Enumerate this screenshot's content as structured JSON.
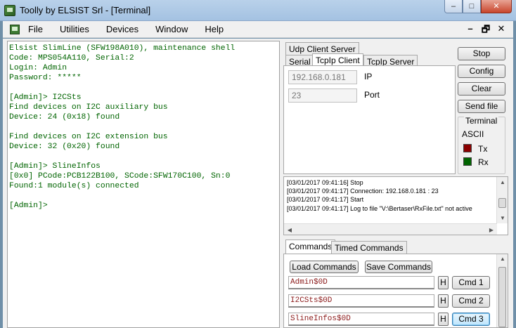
{
  "window": {
    "title": "Toolly by ELSIST Srl - [Terminal]",
    "min_glyph": "–",
    "max_glyph": "□",
    "close_glyph": "✕"
  },
  "menu": {
    "items": [
      "File",
      "Utilities",
      "Devices",
      "Window",
      "Help"
    ],
    "mdi_min": "–",
    "mdi_restore": "🗗",
    "mdi_close": "✕"
  },
  "terminal": {
    "lines": [
      "Elsist SlimLine (SFW198A010), maintenance shell",
      "Code: MPS054A110, Serial:2",
      "Login: Admin",
      "Password: *****",
      "",
      "[Admin]> I2CSts",
      "Find devices on I2C auxiliary bus",
      "Device: 24 (0x18) found",
      "",
      "Find devices on I2C extension bus",
      "Device: 32 (0x20) found",
      "",
      "[Admin]> SlineInfos",
      "[0x0] PCode:PCB122B100, SCode:SFW170C100, Sn:0",
      "Found:1 module(s) connected",
      "",
      "[Admin]>"
    ],
    "color": "#006400"
  },
  "connection": {
    "tabs_top": [
      "Udp Client Server"
    ],
    "tabs": [
      "Serial",
      "TcpIp Client",
      "TcpIp Server"
    ],
    "active_tab": "TcpIp Client",
    "ip_value": "192.168.0.181",
    "ip_label": "IP",
    "port_value": "23",
    "port_label": "Port"
  },
  "side_buttons": {
    "stop": "Stop",
    "config": "Config",
    "clear": "Clear",
    "send_file": "Send file"
  },
  "terminal_group": {
    "title": "Terminal",
    "mode": "ASCII",
    "tx_label": "Tx",
    "rx_label": "Rx",
    "tx_color": "#8b0000",
    "rx_color": "#006400"
  },
  "log": {
    "lines": [
      "[03/01/2017 09:41:16] Stop",
      "[03/01/2017 09:41:17] Connection: 192.168.0.181 : 23",
      "[03/01/2017 09:41:17] Start",
      "[03/01/2017 09:41:17] Log to file \"V:\\Bertaser\\RxFile.txt\" not active"
    ]
  },
  "commands": {
    "tabs": [
      "Commands",
      "Timed Commands"
    ],
    "active_tab": "Commands",
    "load_label": "Load Commands",
    "save_label": "Save Commands",
    "h_label": "H",
    "rows": [
      {
        "value": "Admin$0D",
        "button": "Cmd 1"
      },
      {
        "value": "I2CSts$0D",
        "button": "Cmd 2"
      },
      {
        "value": "SlineInfos$0D",
        "button": "Cmd 3"
      }
    ]
  }
}
